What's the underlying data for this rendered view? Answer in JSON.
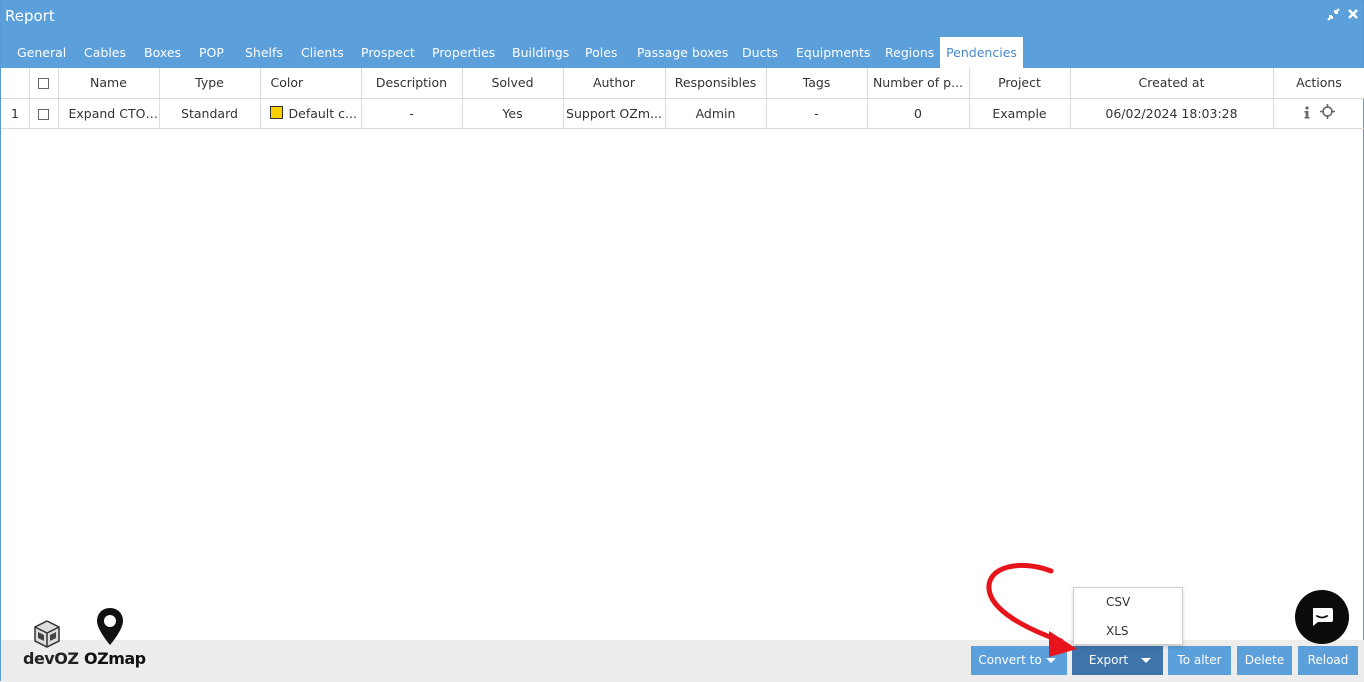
{
  "window": {
    "title": "Report",
    "controls": [
      "restore-icon",
      "close-icon"
    ]
  },
  "tabs": [
    {
      "label": "General"
    },
    {
      "label": "Cables"
    },
    {
      "label": "Boxes"
    },
    {
      "label": "POP"
    },
    {
      "label": "Shelfs"
    },
    {
      "label": "Clients"
    },
    {
      "label": "Prospect"
    },
    {
      "label": "Properties"
    },
    {
      "label": "Buildings"
    },
    {
      "label": "Poles"
    },
    {
      "label": "Passage boxes"
    },
    {
      "label": "Ducts"
    },
    {
      "label": "Equipments"
    },
    {
      "label": "Regions"
    },
    {
      "label": "Pendencies",
      "active": true
    }
  ],
  "table": {
    "headers": [
      "Name",
      "Type",
      "Color",
      "Description",
      "Solved",
      "Author",
      "Responsibles",
      "Tags",
      "Number of p...",
      "Project",
      "Created at",
      "Actions"
    ],
    "rows": [
      {
        "index": "1",
        "name": "Expand CTO -...",
        "type": "Standard",
        "color_label": "Default c...",
        "color_swatch": "#f7d200",
        "description": "-",
        "solved": "Yes",
        "author": "Support OZm...",
        "responsibles": "Admin",
        "tags": "-",
        "number": "0",
        "project": "Example",
        "created_at": "06/02/2024 18:03:28",
        "actions": [
          "info-icon",
          "locate-icon"
        ]
      }
    ]
  },
  "logos": {
    "devoz": "devOZ",
    "ozmap": "OZmap"
  },
  "buttons": {
    "convert": "Convert to",
    "export": "Export",
    "alter": "To alter",
    "delete": "Delete",
    "reload": "Reload"
  },
  "export_menu": [
    "CSV",
    "XLS"
  ],
  "colors": {
    "header_blue": "#5b9fdb",
    "export_active": "#3f74ab",
    "annotation_arrow": "#e8141c"
  }
}
